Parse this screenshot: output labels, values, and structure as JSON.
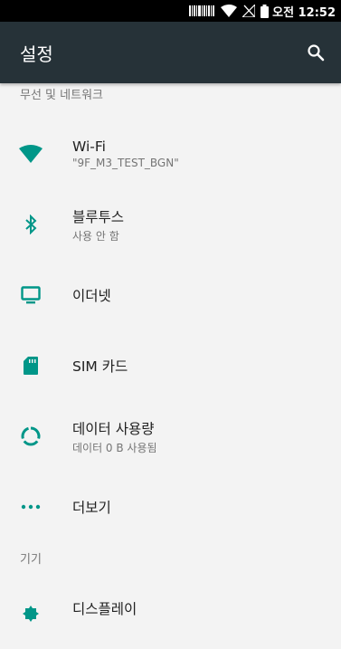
{
  "status_bar": {
    "time": "오전 12:52"
  },
  "app_bar": {
    "title": "설정"
  },
  "sections": [
    {
      "header": "무선 및 네트워크",
      "items": [
        {
          "name": "wifi",
          "icon": "wifi-icon",
          "title": "Wi-Fi",
          "summary": "\"9F_M3_TEST_BGN\""
        },
        {
          "name": "bluetooth",
          "icon": "bluetooth-icon",
          "title": "블루투스",
          "summary": "사용 안 함"
        },
        {
          "name": "ethernet",
          "icon": "monitor-icon",
          "title": "이더넷"
        },
        {
          "name": "sim-cards",
          "icon": "sim-card-icon",
          "title": "SIM 카드"
        },
        {
          "name": "data-usage",
          "icon": "data-usage-icon",
          "title": "데이터 사용량",
          "summary": "데이터 0 B 사용됨"
        },
        {
          "name": "more",
          "icon": "more-dots-icon",
          "title": "더보기"
        }
      ]
    },
    {
      "header": "기기",
      "items": [
        {
          "name": "display",
          "icon": "display-gear-icon",
          "title": "디스플레이"
        }
      ]
    }
  ],
  "colors": {
    "accent": "#009688",
    "app_bar": "#263238",
    "background": "#f3f3f3"
  }
}
